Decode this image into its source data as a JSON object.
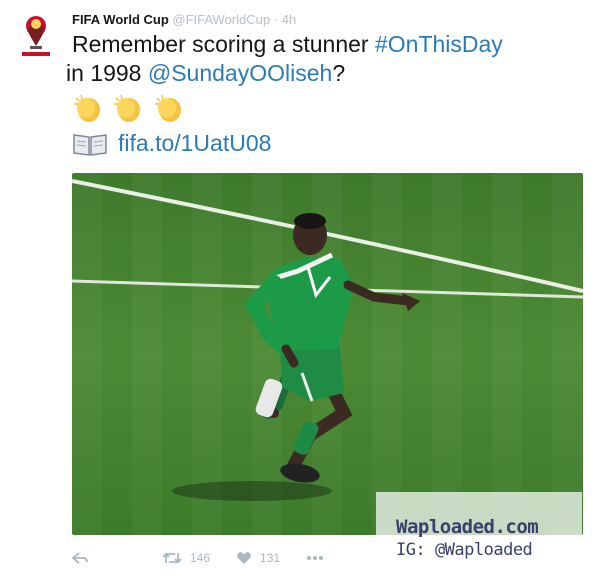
{
  "tweet": {
    "author_name": "FIFA World Cup",
    "author_handle": "@FIFAWorldCup",
    "separator": "·",
    "time": "4h",
    "text_before": "Remember scoring a stunner ",
    "hashtag": "#OnThisDay",
    "text_middle": " in 1998 ",
    "mention": "@SundayOOliseh",
    "text_after": "?",
    "link": "fifa.to/1UatU08"
  },
  "icons": {
    "avatar": "fifa-world-cup-logo",
    "emoji": "clapping-hands",
    "link_icon": "open-book-icon"
  },
  "actions": {
    "retweet_count": "146",
    "like_count": "131"
  },
  "watermark": {
    "line1": "Waploaded.com",
    "line2": "IG: @Waploaded"
  },
  "colors": {
    "link": "#2b7bb9",
    "text": "#14171a",
    "muted": "#aab8c2"
  }
}
